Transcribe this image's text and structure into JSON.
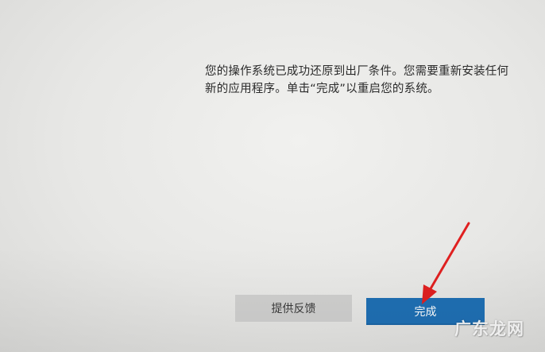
{
  "message": {
    "line1": "您的操作系统已成功还原到出厂条件。您需要重新安装任何",
    "line2": "新的应用程序。单击“完成”以重启您的系统。"
  },
  "buttons": {
    "feedback_label": "提供反馈",
    "done_label": "完成"
  },
  "annotation": {
    "arrow_color": "#e02020"
  },
  "watermark": {
    "text": "广东龙网"
  },
  "colors": {
    "accent_button": "#1f6fb3",
    "secondary_button": "#cfcfce",
    "background": "#e9e9e7"
  }
}
